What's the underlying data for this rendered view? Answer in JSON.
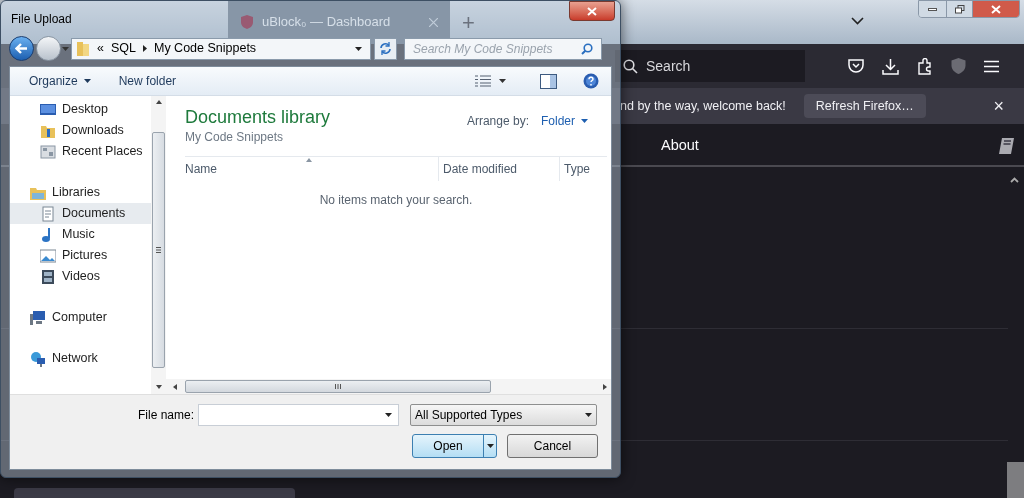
{
  "browser": {
    "tabs": [
      {
        "title": "uBlock₀ — Dashboard",
        "selected": true
      }
    ],
    "new_tab": "+",
    "search": {
      "placeholder": "Search"
    },
    "notification": {
      "message": "nd by the way, welcome back!",
      "button": "Refresh Firefox…",
      "close": "×"
    },
    "nav": [
      {
        "label": "About"
      }
    ],
    "bottom_button": {
      "kind": "button"
    }
  },
  "dialog": {
    "title": "File Upload",
    "address": {
      "overflow": "«",
      "segments": [
        "SQL",
        "My Code Snippets"
      ]
    },
    "search": {
      "placeholder": "Search My Code Snippets"
    },
    "toolbar": [
      {
        "label": "Organize",
        "dropdown": true
      },
      {
        "label": "New folder",
        "dropdown": false
      }
    ],
    "nav_pane": [
      {
        "children": [
          {
            "label": "Desktop",
            "kind": "desktop",
            "selected": false
          },
          {
            "label": "Downloads",
            "kind": "downloads",
            "selected": false
          },
          {
            "label": "Recent Places",
            "kind": "recent",
            "selected": false
          }
        ]
      },
      {
        "label": "Libraries",
        "kind": "libraries",
        "selected": false,
        "children": [
          {
            "label": "Documents",
            "kind": "documents",
            "selected": true
          },
          {
            "label": "Music",
            "kind": "music",
            "selected": false
          },
          {
            "label": "Pictures",
            "kind": "pictures",
            "selected": false
          },
          {
            "label": "Videos",
            "kind": "videos",
            "selected": false
          }
        ]
      },
      {
        "label": "Computer",
        "kind": "computer",
        "selected": false
      },
      {
        "label": "Network",
        "kind": "network",
        "selected": false
      }
    ],
    "library": {
      "title": "Documents library",
      "subtitle": "My Code Snippets",
      "arrange_label": "Arrange by:",
      "arrange_value": "Folder"
    },
    "columns": [
      {
        "label": "Name",
        "sorted": true
      },
      {
        "label": "Date modified",
        "sorted": false
      },
      {
        "label": "Type",
        "sorted": false
      }
    ],
    "empty_message": "No items match your search.",
    "file_name": {
      "label": "File name:"
    },
    "file_type": "All Supported Types",
    "buttons": [
      {
        "label": "Open",
        "kind": "split",
        "default": true
      },
      {
        "label": "Cancel",
        "kind": "plain",
        "default": false
      }
    ]
  }
}
